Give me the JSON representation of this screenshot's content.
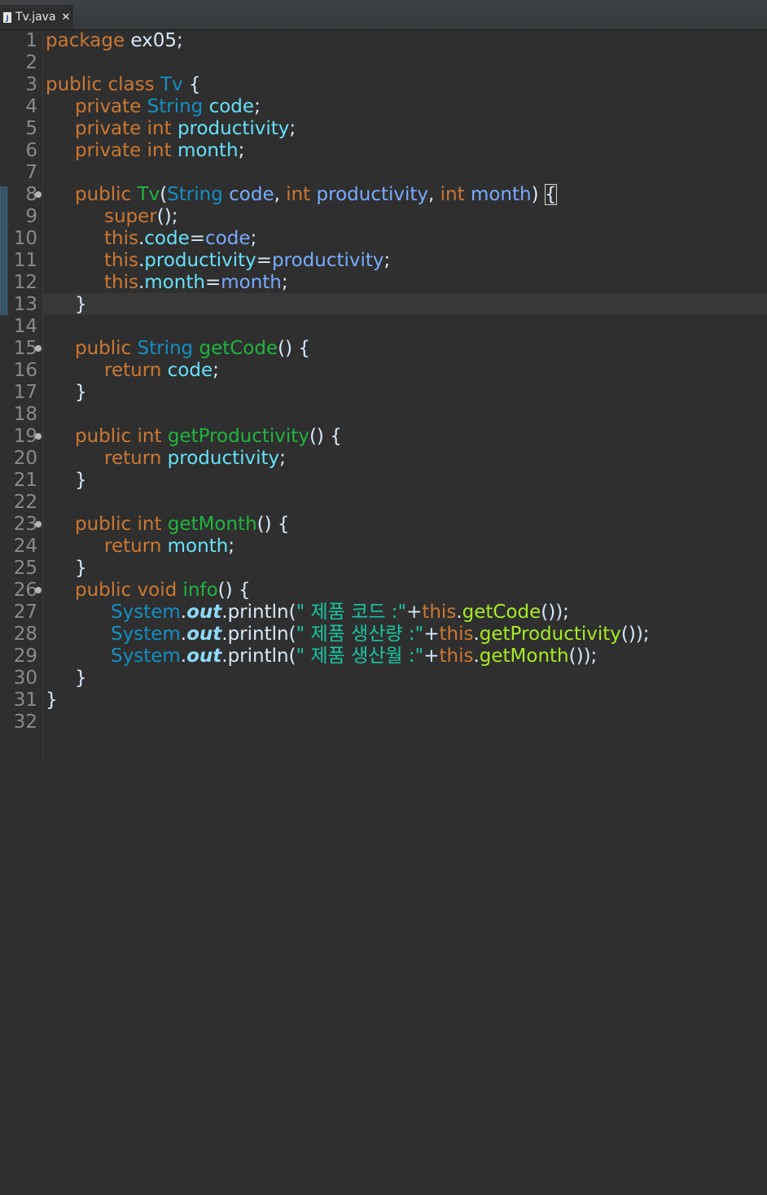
{
  "tab": {
    "title": "Tv.java",
    "close": "✕",
    "file_icon": "java-file-icon"
  },
  "line_numbers": [
    "1",
    "2",
    "3",
    "4",
    "5",
    "6",
    "7",
    "8",
    "9",
    "10",
    "11",
    "12",
    "13",
    "14",
    "15",
    "16",
    "17",
    "18",
    "19",
    "20",
    "21",
    "22",
    "23",
    "24",
    "25",
    "26",
    "27",
    "28",
    "29",
    "30",
    "31",
    "32"
  ],
  "code": {
    "l1_kw": "package",
    "l1_rest": " ex05;",
    "l3_kw": "public class ",
    "l3_ty": "Tv",
    "l3_rest": " {",
    "l4_kw": "private ",
    "l4_ty": "String",
    "l4_fld": " code",
    "l4_end": ";",
    "l5_kw": "private int ",
    "l5_fld": "productivity",
    "l5_end": ";",
    "l6_kw": "private int ",
    "l6_fld": "month",
    "l6_end": ";",
    "l8_kw": "public ",
    "l8_fn": "Tv",
    "l8_p1": "(",
    "l8_ty": "String",
    "l8_a1": " code",
    "l8_c1": ", ",
    "l8_kw2": "int",
    "l8_a2": " productivity",
    "l8_c2": ", ",
    "l8_kw3": "int",
    "l8_a3": " month",
    "l8_p2": ") ",
    "l8_brace": "{",
    "l9_kw": "super",
    "l9_rest": "();",
    "l10_kw": "this",
    "l10_dot": ".",
    "l10_fld": "code",
    "l10_eq": "=",
    "l10_par": "code",
    "l10_end": ";",
    "l11_kw": "this",
    "l11_dot": ".",
    "l11_fld": "productivity",
    "l11_eq": "=",
    "l11_par": "productivity",
    "l11_end": ";",
    "l12_kw": "this",
    "l12_dot": ".",
    "l12_fld": "month",
    "l12_eq": "=",
    "l12_par": "month",
    "l12_end": ";",
    "l13": "}",
    "l15_kw": "public ",
    "l15_ty": "String",
    "l15_fn": " getCode",
    "l15_rest": "() {",
    "l16_kw": "return ",
    "l16_fld": "code",
    "l16_end": ";",
    "l17": "}",
    "l19_kw": "public int ",
    "l19_fn": "getProductivity",
    "l19_rest": "() {",
    "l20_kw": "return ",
    "l20_fld": "productivity",
    "l20_end": ";",
    "l21": "}",
    "l23_kw": "public int ",
    "l23_fn": "getMonth",
    "l23_rest": "() {",
    "l24_kw": "return ",
    "l24_fld": "month",
    "l24_end": ";",
    "l25": "}",
    "l26_kw": "public void ",
    "l26_fn": "info",
    "l26_rest": "() {",
    "l27_ty": "System",
    "l27_dot": ".",
    "l27_st": "out",
    "l27_dot2": ".println(",
    "l27_str": "\" 제품 코드 :\"",
    "l27_plus": "+",
    "l27_kw": "this",
    "l27_dot3": ".",
    "l27_m": "getCode",
    "l27_end": "());",
    "l28_ty": "System",
    "l28_dot": ".",
    "l28_st": "out",
    "l28_dot2": ".println(",
    "l28_str": "\" 제품 생산량 :\"",
    "l28_plus": "+",
    "l28_kw": "this",
    "l28_dot3": ".",
    "l28_m": "getProductivity",
    "l28_end": "());",
    "l29_ty": "System",
    "l29_dot": ".",
    "l29_st": "out",
    "l29_dot2": ".println(",
    "l29_str": "\" 제품 생산월 :\"",
    "l29_plus": "+",
    "l29_kw": "this",
    "l29_dot3": ".",
    "l29_m": "getMonth",
    "l29_end": "());",
    "l30": "}",
    "l31": "}"
  },
  "colors": {
    "background": "#2f2f2f",
    "keyword": "#cc7832",
    "type": "#1290c3",
    "method_decl": "#1eb540",
    "field": "#66e1f8",
    "parameter": "#79abff",
    "string": "#17c6a3",
    "static_field": "#8ddaf8",
    "method_call": "#a7ec21"
  }
}
